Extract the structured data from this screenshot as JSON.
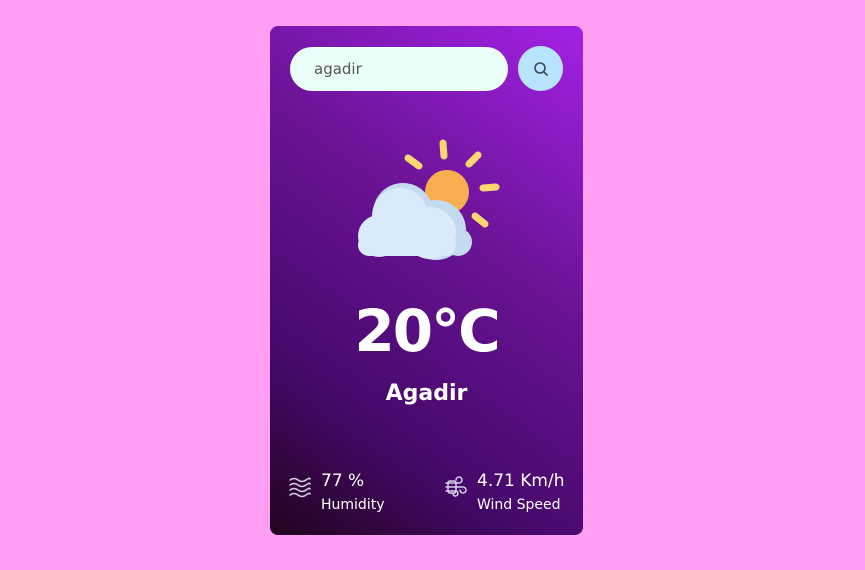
{
  "search": {
    "value": "agadir"
  },
  "icons": {
    "search": "search-icon",
    "weather": "partly-cloudy-icon",
    "humidity": "humidity-waves-icon",
    "wind": "wind-icon"
  },
  "weather": {
    "temperature": "20°C",
    "city": "Agadir"
  },
  "details": {
    "humidity": {
      "value": "77 %",
      "label": "Humidity"
    },
    "wind": {
      "value": "4.71 Km/h",
      "label": "Wind Speed"
    }
  },
  "colors": {
    "page_background": "#ff9ef2",
    "card_gradient_top": "#a321e6",
    "card_gradient_bottom": "#22031d",
    "search_field": "#eafff9",
    "search_button": "#b8e4ff",
    "sun": "#f6ae4f",
    "sun_rays": "#ffd770",
    "cloud": "#d9ebfb",
    "text": "#ffffff"
  }
}
